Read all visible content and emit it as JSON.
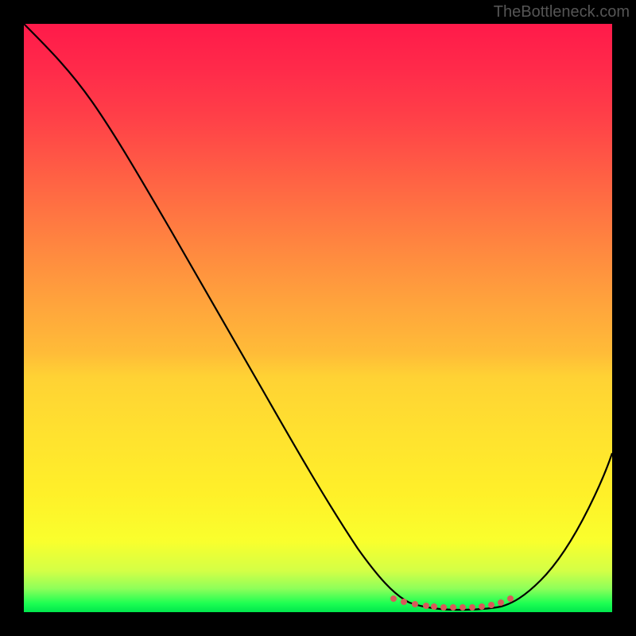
{
  "watermark": "TheBottleneck.com",
  "chart_data": {
    "type": "line",
    "title": "",
    "xlabel": "",
    "ylabel": "",
    "xlim": [
      0,
      100
    ],
    "ylim": [
      0,
      100
    ],
    "series": [
      {
        "name": "bottleneck-curve",
        "x": [
          0,
          5,
          10,
          15,
          20,
          25,
          30,
          35,
          40,
          45,
          50,
          55,
          60,
          62,
          65,
          68,
          70,
          72,
          75,
          78,
          80,
          82,
          85,
          88,
          90,
          93,
          96,
          100
        ],
        "y": [
          100,
          96,
          91,
          85,
          78,
          71,
          64,
          57,
          50,
          42,
          34,
          26,
          17,
          13,
          8,
          4,
          2,
          1,
          0.5,
          0.5,
          0.5,
          0.8,
          2,
          5,
          9,
          15,
          23,
          35
        ]
      }
    ],
    "highlight_points": {
      "name": "optimal-range-dots",
      "x": [
        63,
        65,
        67,
        69,
        70,
        72,
        73,
        75,
        77,
        79,
        80,
        82,
        84
      ],
      "y": [
        2.5,
        2,
        1.5,
        1.2,
        1,
        0.8,
        0.8,
        0.8,
        0.8,
        0.9,
        1,
        1.5,
        2
      ]
    },
    "gradient_colors": {
      "top": "#ff1a4a",
      "mid_upper": "#ff7442",
      "mid": "#ffd234",
      "mid_lower": "#f9ff2d",
      "bottom": "#00e64d"
    }
  }
}
